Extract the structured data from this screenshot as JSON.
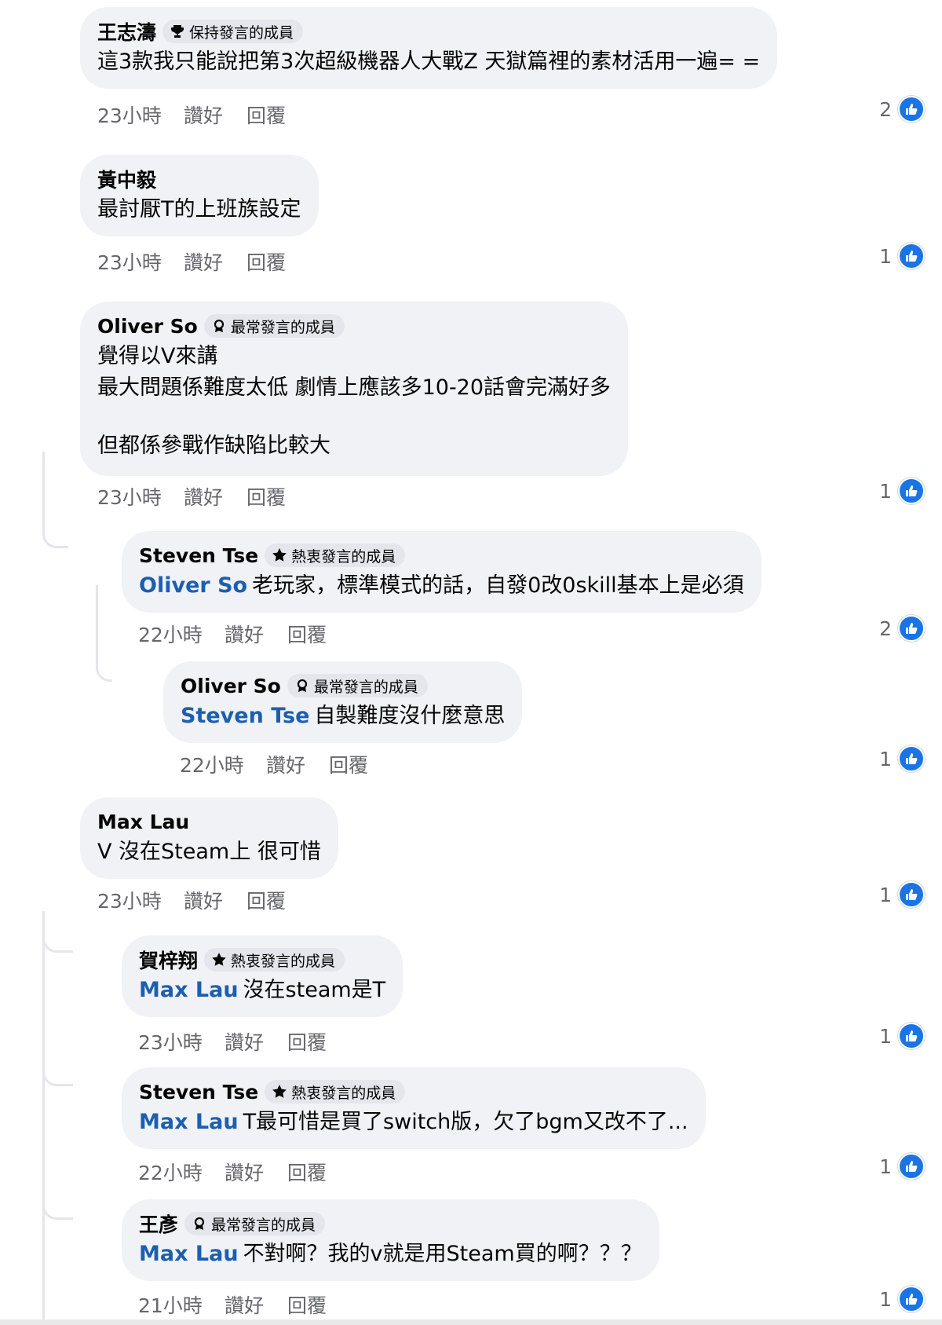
{
  "actions": {
    "like": "讚好",
    "reply": "回覆"
  },
  "comments": [
    {
      "author": "王志濤",
      "badge": "保持發言的成員",
      "lines": [
        "這3款我只能說把第3次超級機器人大戰Z 天獄篇裡的素材活用一遍= ="
      ],
      "time": "23小時",
      "reactions": "2"
    },
    {
      "author": "黃中毅",
      "lines": [
        "最討厭T的上班族設定"
      ],
      "time": "23小時",
      "reactions": "1"
    },
    {
      "author": "Oliver So",
      "badge": "最常發言的成員",
      "lines": [
        "覺得以V來講",
        "最大問題係難度太低 劇情上應該多10-20話會完滿好多",
        "但都係參戰作缺陷比較大"
      ],
      "time": "23小時",
      "reactions": "1"
    },
    {
      "author": "Steven Tse",
      "badge": "熱衷發言的成員",
      "mention": "Oliver So",
      "lines": [
        "老玩家，標準模式的話，自發0改0skill基本上是必須"
      ],
      "time": "22小時",
      "reactions": "2"
    },
    {
      "author": "Oliver So",
      "badge": "最常發言的成員",
      "mention": "Steven Tse",
      "lines": [
        "自製難度沒什麼意思"
      ],
      "time": "22小時",
      "reactions": "1"
    },
    {
      "author": "Max Lau",
      "lines": [
        "V 沒在Steam上 很可惜"
      ],
      "time": "23小時",
      "reactions": "1"
    },
    {
      "author": "賀梓翔",
      "badge": "熱衷發言的成員",
      "mention": "Max Lau",
      "lines": [
        "沒在steam是T"
      ],
      "time": "23小時",
      "reactions": "1"
    },
    {
      "author": "Steven Tse",
      "badge": "熱衷發言的成員",
      "mention": "Max Lau",
      "lines": [
        "T最可惜是買了switch版，欠了bgm又改不了..."
      ],
      "time": "22小時",
      "reactions": "1"
    },
    {
      "author": "王彥",
      "badge": "最常發言的成員",
      "mention": "Max Lau",
      "lines": [
        "不對啊？我的v就是用Steam買的啊？？？"
      ],
      "time": "21小時",
      "reactions": "1"
    }
  ]
}
